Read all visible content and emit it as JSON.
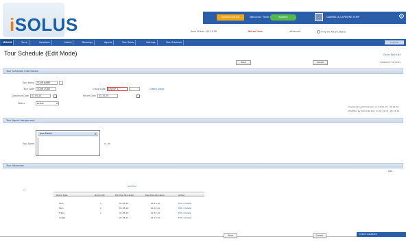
{
  "app": {
    "logo_i": "i",
    "logo_rest": "SOLUS"
  },
  "topbar": {
    "search_button": "Search iSOLUS",
    "account_text": "Welcome · Rene Stieler",
    "badge": "Bulletin",
    "user_text": "GABRIELLE.LAPIERRE.TEMP",
    "gear": "⚙"
  },
  "subbar": {
    "items": [
      "Rene Stieler · 05.14.10",
      "Refresh Now",
      "Advanced",
      "Only On Active Status"
    ]
  },
  "nav": {
    "items": [
      "iSOLUS",
      "Tours",
      "Vacations",
      "Hotels",
      "Bookings",
      "Agents",
      "Tour Rates",
      "Settings",
      "Tour Schedule"
    ],
    "subnav": "Log Out"
  },
  "page": {
    "title": "Tour Schedule (Edit Mode)",
    "right_link": "Go to Tour List",
    "right_sub": "Customer Services",
    "save_button": "Save",
    "cancel_button": "Cancel",
    "save_button_bottom": "Save",
    "cancel_button_bottom": "Cancel"
  },
  "sections": {
    "info": "Tour Schedule Information",
    "agent": "Tour Agent Assignment",
    "allocation": "Tour Allocation"
  },
  "form": {
    "tour_label": "Tour Name",
    "tour_value": "TOUR NAME",
    "code_label": "Tour Code",
    "code_value": "TOUR CODE",
    "group_label": "Group Code",
    "group_value": "GROUP 1",
    "group_link": "Create Group",
    "start_label": "Departure Date",
    "start_value": "01.05.10",
    "end_label": "Return Date",
    "end_value": "01.15.10",
    "status_label": "Status",
    "status_value": "Active",
    "note_line1": "Created by Administrator on 01.01.10 · 05.14.10",
    "note_line2": "Modified by Administrator on 05.14.10 · 05.14.10"
  },
  "agent": {
    "list_label": "Tour Agent",
    "selected": "Jean Martin",
    "count": "01.05"
  },
  "allocation": {
    "add_link": "Add",
    "header_link": "Add Tour",
    "headers": [
      "Room Type",
      "Room Qty",
      "Min Pax Allocation",
      "Max Pax Allocation",
      "Action"
    ],
    "rows": [
      [
        "Twin",
        "1",
        "01.05.10",
        "01.15.10",
        "Edit / Delete"
      ],
      [
        "Twin",
        "2",
        "01.05.10",
        "01.15.10",
        "Edit / Delete"
      ],
      [
        "Triple",
        "1",
        "01.05.10",
        "01.15.10",
        "Edit / Delete"
      ],
      [
        "Single",
        "",
        "01.05.10",
        "01.15.10",
        "Edit / Delete"
      ]
    ]
  },
  "chat": {
    "label": "Online Assistant"
  }
}
